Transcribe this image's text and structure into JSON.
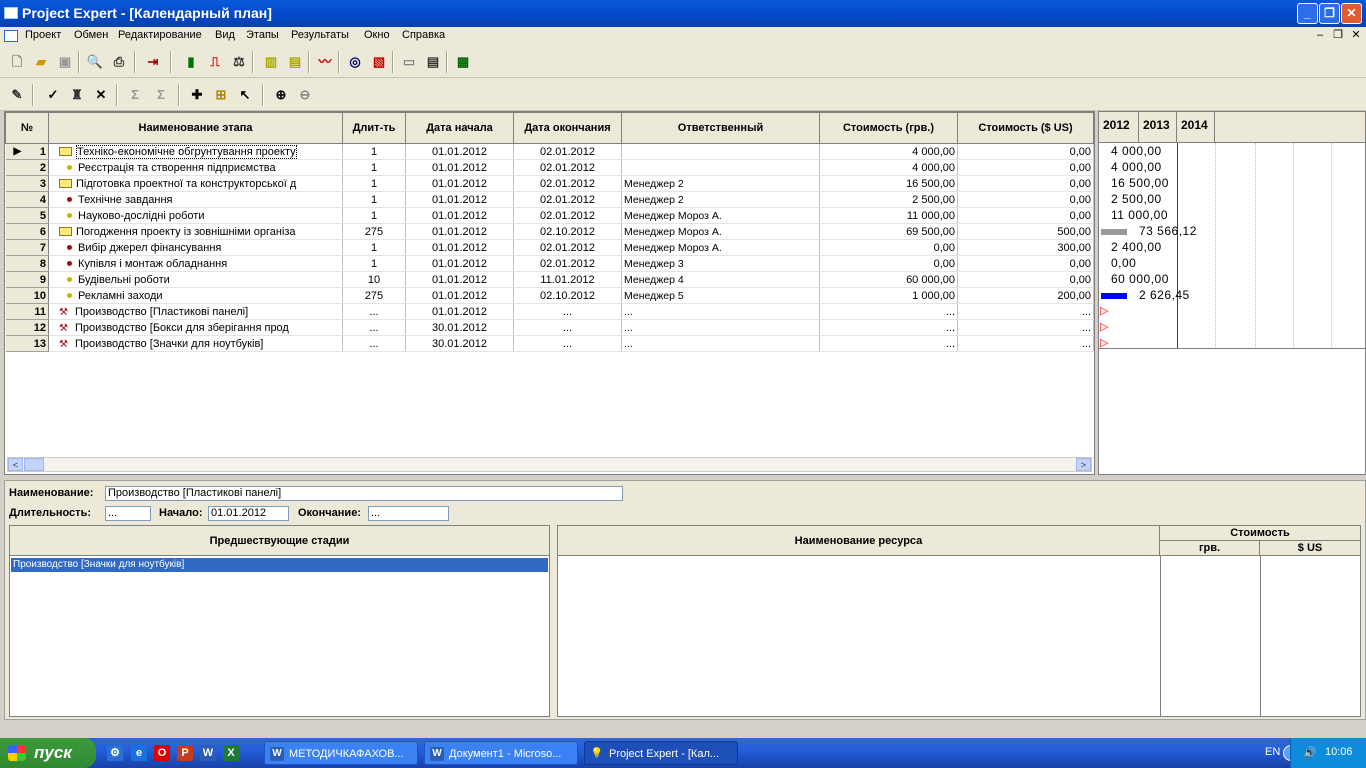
{
  "window": {
    "title": "Project Expert - [Календарный план]"
  },
  "menu": [
    "Проект",
    "Обмен",
    "Редактирование",
    "Вид",
    "Этапы",
    "Результаты",
    "Окно",
    "Справка"
  ],
  "columns": [
    "№",
    "Наименование этапа",
    "Длит-ть",
    "Дата начала",
    "Дата окончания",
    "Ответственный",
    "Стоимость (грв.)",
    "Стоимость ($ US)"
  ],
  "rows": [
    {
      "no": "1",
      "kind": "folder",
      "level": 0,
      "name": "Техніко-економічне обгрунтування проекту",
      "dur": "1",
      "start": "01.01.2012",
      "end": "02.01.2012",
      "resp": "",
      "cost_uah": "4 000,00",
      "cost_usd": "0,00"
    },
    {
      "no": "2",
      "kind": "task-yellow",
      "level": 1,
      "name": "Реєстрація та створення підприємства",
      "dur": "1",
      "start": "01.01.2012",
      "end": "02.01.2012",
      "resp": "",
      "cost_uah": "4 000,00",
      "cost_usd": "0,00"
    },
    {
      "no": "3",
      "kind": "folder",
      "level": 0,
      "name": "Підготовка проектної та конструкторської д",
      "dur": "1",
      "start": "01.01.2012",
      "end": "02.01.2012",
      "resp": "Менеджер 2",
      "cost_uah": "16 500,00",
      "cost_usd": "0,00"
    },
    {
      "no": "4",
      "kind": "task-red",
      "level": 1,
      "name": "Технічне завдання",
      "dur": "1",
      "start": "01.01.2012",
      "end": "02.01.2012",
      "resp": "Менеджер 2",
      "cost_uah": "2 500,00",
      "cost_usd": "0,00"
    },
    {
      "no": "5",
      "kind": "task-yellow",
      "level": 1,
      "name": "Науково-дослідні роботи",
      "dur": "1",
      "start": "01.01.2012",
      "end": "02.01.2012",
      "resp": "Менеджер Мороз А.",
      "cost_uah": "11 000,00",
      "cost_usd": "0,00"
    },
    {
      "no": "6",
      "kind": "folder",
      "level": 0,
      "name": "Погодження проекту із зовнішніми організа",
      "dur": "275",
      "start": "01.01.2012",
      "end": "02.10.2012",
      "resp": "Менеджер Мороз А.",
      "cost_uah": "69 500,00",
      "cost_usd": "500,00"
    },
    {
      "no": "7",
      "kind": "task-red",
      "level": 1,
      "name": "Вибір джерел фінансування",
      "dur": "1",
      "start": "01.01.2012",
      "end": "02.01.2012",
      "resp": "Менеджер Мороз А.",
      "cost_uah": "0,00",
      "cost_usd": "300,00"
    },
    {
      "no": "8",
      "kind": "task-red",
      "level": 1,
      "name": "Купівля і монтаж обладнання",
      "dur": "1",
      "start": "01.01.2012",
      "end": "02.01.2012",
      "resp": "Менеджер 3",
      "cost_uah": "0,00",
      "cost_usd": "0,00"
    },
    {
      "no": "9",
      "kind": "task-yellow",
      "level": 1,
      "name": "Будівельні роботи",
      "dur": "10",
      "start": "01.01.2012",
      "end": "11.01.2012",
      "resp": "Менеджер 4",
      "cost_uah": "60 000,00",
      "cost_usd": "0,00"
    },
    {
      "no": "10",
      "kind": "task-yellow",
      "level": 1,
      "name": "Рекламні заходи",
      "dur": "275",
      "start": "01.01.2012",
      "end": "02.10.2012",
      "resp": "Менеджер 5",
      "cost_uah": "1 000,00",
      "cost_usd": "200,00"
    },
    {
      "no": "11",
      "kind": "prod",
      "level": 0,
      "name": "Производство [Пластикові панелі]",
      "dur": "...",
      "start": "01.01.2012",
      "end": "...",
      "resp": "...",
      "cost_uah": "...",
      "cost_usd": "..."
    },
    {
      "no": "12",
      "kind": "prod",
      "level": 0,
      "name": "Производство [Бокси для зберігання прод",
      "dur": "...",
      "start": "30.01.2012",
      "end": "...",
      "resp": "...",
      "cost_uah": "...",
      "cost_usd": "..."
    },
    {
      "no": "13",
      "kind": "prod",
      "level": 0,
      "name": "Производство [Значки для ноутбуків]",
      "dur": "...",
      "start": "30.01.2012",
      "end": "...",
      "resp": "...",
      "cost_uah": "...",
      "cost_usd": "..."
    }
  ],
  "gantt": {
    "years": [
      "2012",
      "2013",
      "2014"
    ],
    "labels": [
      "4 000,00",
      "4 000,00",
      "16 500,00",
      "2 500,00",
      "11 000,00",
      "73 566,12",
      "2 400,00",
      "0,00",
      "60 000,00",
      "2 626,45",
      "",
      "",
      ""
    ],
    "bar_colors": {
      "summary": "#999999",
      "task": "#0000ff",
      "milestone": "#ff0000",
      "today_line": "#cc0000"
    }
  },
  "details": {
    "name_label": "Наименование:",
    "name_value": "Производство [Пластикові панелі]",
    "dur_label": "Длительность:",
    "dur_value": "...",
    "start_label": "Начало:",
    "start_value": "01.01.2012",
    "end_label": "Окончание:",
    "end_value": "...",
    "pred_header": "Предшествующие стадии",
    "pred_items": [
      "Производство [Значки для ноутбуків]"
    ],
    "res_header": "Наименование ресурса",
    "cost_header": "Стоимость",
    "cost_uah": "грв.",
    "cost_usd": "$ US"
  },
  "taskbar": {
    "start": "пуск",
    "tasks": [
      "МЕТОДИЧКАФАХОВ...",
      "Документ1 - Microso...",
      "Project Expert - [Кал..."
    ],
    "lang": "EN",
    "clock": "10:06"
  }
}
